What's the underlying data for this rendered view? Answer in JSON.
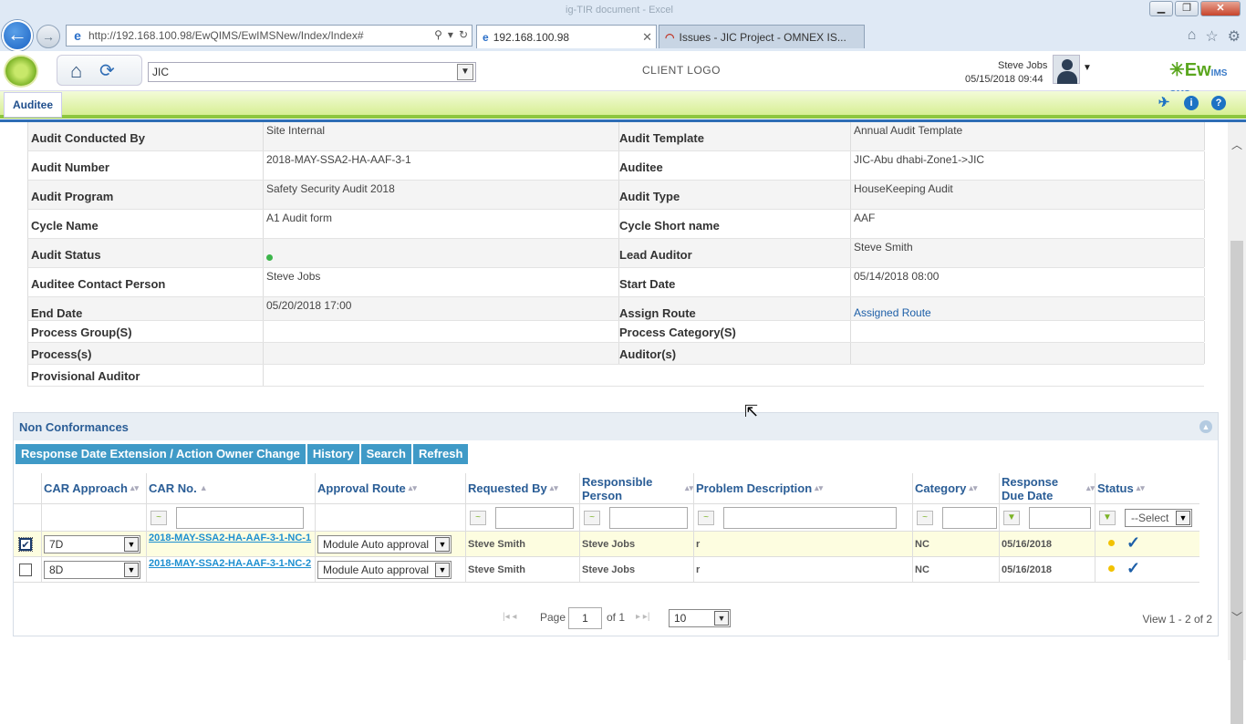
{
  "browser": {
    "title": "ig-TIR document - Excel",
    "url": "http://192.168.100.98/EwQIMS/EwIMSNew/Index/Index#",
    "tabs": [
      {
        "label": "192.168.100.98",
        "active": true
      },
      {
        "label": "Issues - JIC Project - OMNEX IS...",
        "active": false
      }
    ]
  },
  "header": {
    "site_select": "JIC",
    "client_logo": "CLIENT LOGO",
    "user_name": "Steve Jobs",
    "user_datetime": "05/15/2018 09:44",
    "brand": "Ew",
    "brand_suffix": "IMS QMS"
  },
  "toolbar": {
    "tab_label": "Auditee"
  },
  "details": {
    "rows": [
      {
        "l1": "Audit Conducted By",
        "v1": "Site Internal",
        "l2": "Audit Template",
        "v2": "Annual Audit Template"
      },
      {
        "l1": "Audit Number",
        "v1": "2018-MAY-SSA2-HA-AAF-3-1",
        "l2": "Auditee",
        "v2": "JIC-Abu dhabi-Zone1->JIC"
      },
      {
        "l1": "Audit Program",
        "v1": "Safety Security Audit 2018",
        "l2": "Audit Type",
        "v2": "HouseKeeping Audit"
      },
      {
        "l1": "Cycle Name",
        "v1": "A1 Audit form",
        "l2": "Cycle Short name",
        "v2": "AAF"
      },
      {
        "l1": "Audit Status",
        "v1": "",
        "l2": "Lead Auditor",
        "v2": "Steve Smith"
      },
      {
        "l1": "Auditee Contact Person",
        "v1": "Steve Jobs",
        "l2": "Start Date",
        "v2": "05/14/2018 08:00"
      },
      {
        "l1": "End Date",
        "v1": "05/20/2018 17:00",
        "l2": "Assign Route",
        "v2": "Assigned Route"
      },
      {
        "l1": "Process Group(S)",
        "v1": "",
        "l2": "Process Category(S)",
        "v2": ""
      },
      {
        "l1": "Process(s)",
        "v1": "",
        "l2": "Auditor(s)",
        "v2": ""
      },
      {
        "l1": "Provisional Auditor",
        "v1": "",
        "l2": "",
        "v2": ""
      }
    ],
    "status_color": "#3cb54a"
  },
  "nc": {
    "title": "Non Conformances",
    "buttons": [
      "Response Date Extension / Action Owner Change",
      "History",
      "Search",
      "Refresh"
    ],
    "columns": [
      "CAR Approach",
      "CAR No.",
      "Approval Route",
      "Requested By",
      "Responsible Person",
      "Problem Description",
      "Category",
      "Response Due Date",
      "Status"
    ],
    "status_filter": "--Select",
    "rows": [
      {
        "checked": true,
        "approach": "7D",
        "car_no": "2018-MAY-SSA2-HA-AAF-3-1-NC-1",
        "route": "Module Auto approval",
        "requested_by": "Steve Smith",
        "responsible": "Steve Jobs",
        "problem": "r",
        "category": "NC",
        "due": "05/16/2018"
      },
      {
        "checked": false,
        "approach": "8D",
        "car_no": "2018-MAY-SSA2-HA-AAF-3-1-NC-2",
        "route": "Module Auto approval",
        "requested_by": "Steve Smith",
        "responsible": "Steve Jobs",
        "problem": "r",
        "category": "NC",
        "due": "05/16/2018"
      }
    ],
    "pager": {
      "page_label": "Page",
      "page": "1",
      "of_label": "of 1",
      "page_size": "10",
      "summary": "View 1 - 2 of 2"
    }
  }
}
